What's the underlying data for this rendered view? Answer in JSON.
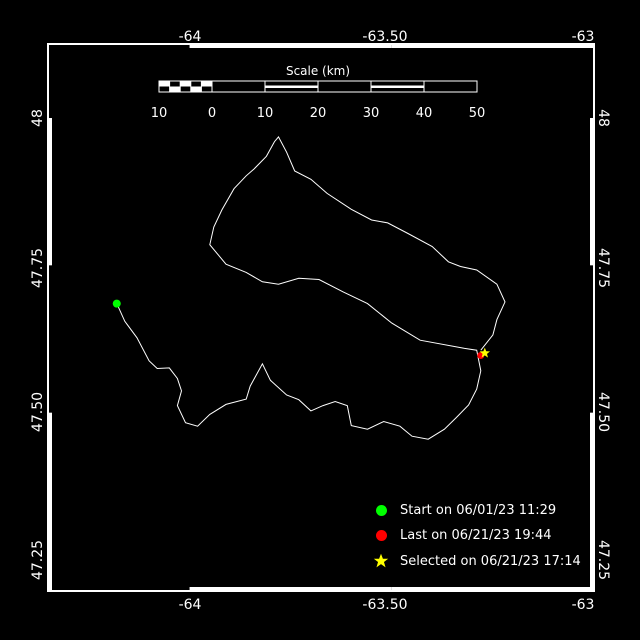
{
  "axes": {
    "top_ticks": [
      "-64",
      "-63.50",
      "-63"
    ],
    "bottom_ticks": [
      "-64",
      "-63.50",
      "-63"
    ],
    "left_ticks": [
      "48",
      "47.75",
      "47.50",
      "47.25"
    ],
    "right_ticks": [
      "48",
      "47.75",
      "47.50",
      "47.25"
    ]
  },
  "scale_bar": {
    "title": "Scale (km)",
    "labels": [
      "10",
      "0",
      "10",
      "20",
      "30",
      "40",
      "50"
    ]
  },
  "legend": {
    "start": "Start on 06/01/23 11:29",
    "last": "Last on 06/21/23 19:44",
    "selected": "Selected on 06/21/23 17:14"
  },
  "colors": {
    "background": "#000000",
    "frame": "#ffffff",
    "track": "#ffffff",
    "start": "#00ff00",
    "last": "#ff0000",
    "selected": "#ffff00"
  },
  "track": {
    "units": "degrees",
    "points": [
      [
        -64.18,
        47.685
      ],
      [
        -64.16,
        47.655
      ],
      [
        -64.13,
        47.627
      ],
      [
        -64.1,
        47.588
      ],
      [
        -64.08,
        47.575
      ],
      [
        -64.05,
        47.576
      ],
      [
        -64.03,
        47.558
      ],
      [
        -64.02,
        47.537
      ],
      [
        -64.03,
        47.512
      ],
      [
        -64.01,
        47.483
      ],
      [
        -63.98,
        47.477
      ],
      [
        -63.95,
        47.497
      ],
      [
        -63.91,
        47.514
      ],
      [
        -63.86,
        47.523
      ],
      [
        -63.85,
        47.545
      ],
      [
        -63.82,
        47.583
      ],
      [
        -63.8,
        47.555
      ],
      [
        -63.76,
        47.53
      ],
      [
        -63.73,
        47.522
      ],
      [
        -63.7,
        47.503
      ],
      [
        -63.67,
        47.512
      ],
      [
        -63.64,
        47.519
      ],
      [
        -63.61,
        47.512
      ],
      [
        -63.6,
        47.478
      ],
      [
        -63.56,
        47.472
      ],
      [
        -63.52,
        47.485
      ],
      [
        -63.48,
        47.477
      ],
      [
        -63.45,
        47.46
      ],
      [
        -63.41,
        47.455
      ],
      [
        -63.37,
        47.472
      ],
      [
        -63.34,
        47.492
      ],
      [
        -63.31,
        47.513
      ],
      [
        -63.29,
        47.54
      ],
      [
        -63.28,
        47.571
      ],
      [
        -63.29,
        47.606
      ],
      [
        -63.32,
        47.609
      ],
      [
        -63.43,
        47.623
      ],
      [
        -63.5,
        47.652
      ],
      [
        -63.56,
        47.685
      ],
      [
        -63.62,
        47.705
      ],
      [
        -63.68,
        47.726
      ],
      [
        -63.73,
        47.728
      ],
      [
        -63.78,
        47.718
      ],
      [
        -63.82,
        47.722
      ],
      [
        -63.86,
        47.738
      ],
      [
        -63.91,
        47.752
      ],
      [
        -63.95,
        47.785
      ],
      [
        -63.94,
        47.815
      ],
      [
        -63.92,
        47.844
      ],
      [
        -63.89,
        47.88
      ],
      [
        -63.86,
        47.902
      ],
      [
        -63.84,
        47.914
      ],
      [
        -63.81,
        47.935
      ],
      [
        -63.79,
        47.96
      ],
      [
        -63.78,
        47.968
      ],
      [
        -63.76,
        47.942
      ],
      [
        -63.74,
        47.91
      ],
      [
        -63.7,
        47.896
      ],
      [
        -63.66,
        47.872
      ],
      [
        -63.6,
        47.845
      ],
      [
        -63.55,
        47.827
      ],
      [
        -63.51,
        47.822
      ],
      [
        -63.46,
        47.804
      ],
      [
        -63.4,
        47.782
      ],
      [
        -63.36,
        47.756
      ],
      [
        -63.33,
        47.748
      ],
      [
        -63.29,
        47.742
      ],
      [
        -63.24,
        47.718
      ],
      [
        -63.22,
        47.688
      ],
      [
        -63.24,
        47.658
      ],
      [
        -63.25,
        47.632
      ],
      [
        -63.28,
        47.606
      ]
    ]
  },
  "markers": {
    "start": [
      -64.18,
      47.685
    ],
    "last": [
      -63.28,
      47.597
    ],
    "selected": [
      -63.27,
      47.601
    ]
  }
}
